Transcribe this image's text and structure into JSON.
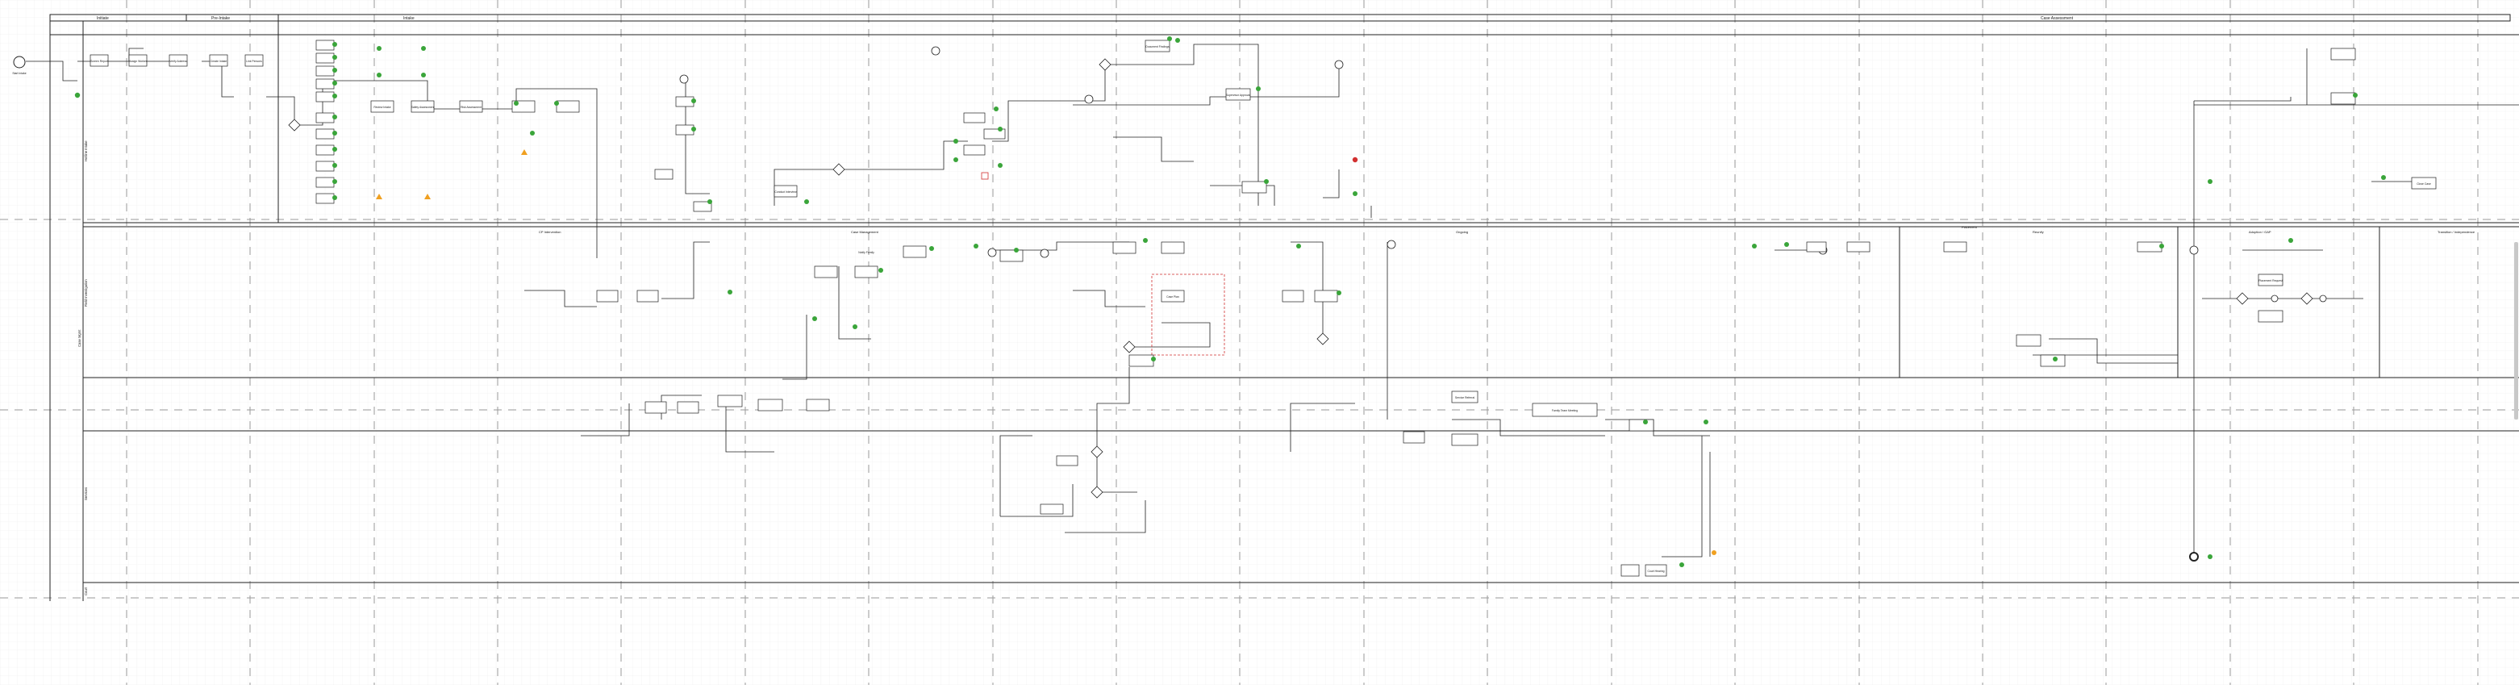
{
  "canvas": {
    "background": "#ffffff",
    "grid_color": "#e3e3e3",
    "dash_color": "#9a9a9a",
    "task_fill": "#ffffff",
    "line_color": "#222222",
    "badge_green": "#3aa53a",
    "badge_red": "#d23030",
    "badge_orange": "#f0a020"
  },
  "phases": {
    "p1": "Initiate",
    "p2": "Pre-Intake",
    "p3": "Intake",
    "p4": "Case Assessment"
  },
  "sections": {
    "s1": "CP Intervention",
    "s2": "Case Management",
    "s3": "Ongoing",
    "s4": "Placement",
    "s5": "Reunify",
    "s6": "Adoption / GAP",
    "s7": "Transition / Independence",
    "s8": "Post-Perm / Case Closing"
  },
  "lanes": {
    "l1": "Hotline Intake",
    "l2": "Field Investigation",
    "l3": "Case Mgmt",
    "l4": "Services",
    "l5": "Court"
  },
  "events": {
    "start": "Start Intake",
    "service": "Services Closed",
    "end": "Case Closed"
  },
  "tasks": {
    "t1": "Screen Report",
    "t2": "Assign Worker",
    "t3": "Verify Address",
    "t4": "Create Intake",
    "t5": "Link Persons",
    "t6": "Review Intake",
    "t7": "Safety Assessment",
    "t8": "Risk Assessment",
    "t9": "Conduct Interview",
    "t10": "Document Findings",
    "t11": "Supervisor Approval",
    "t12": "Notify Family",
    "t13": "Case Plan",
    "t14": "Family Team Meeting",
    "t15": "Service Referral",
    "t16": "Placement Request",
    "t17": "Court Hearing",
    "t18": "Close Case"
  }
}
